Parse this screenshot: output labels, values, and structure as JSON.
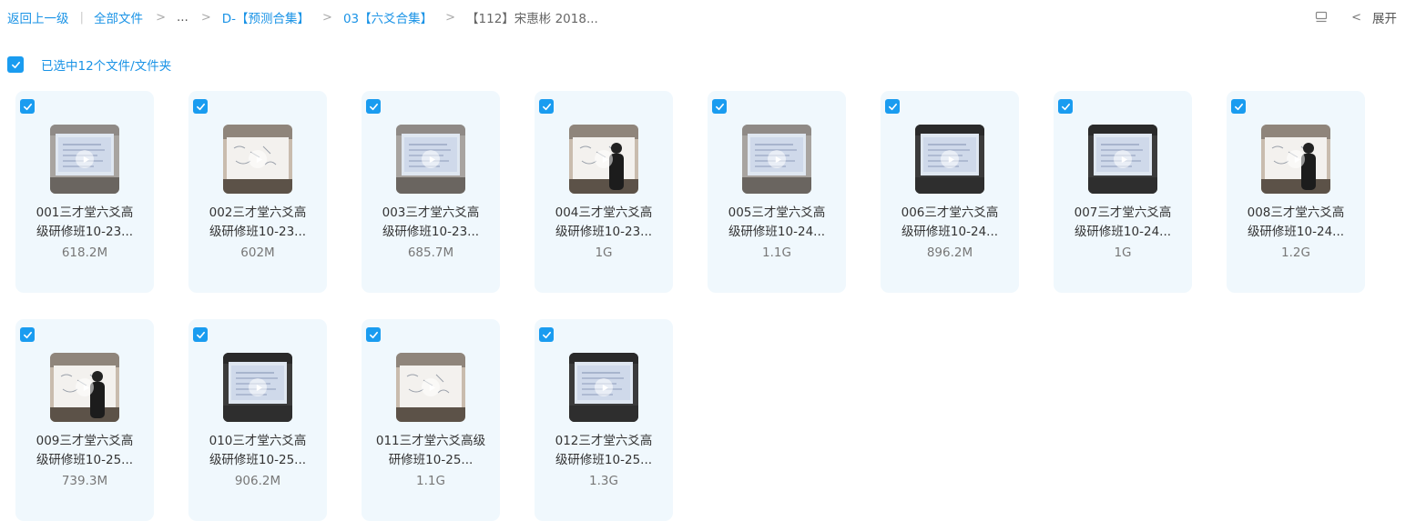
{
  "breadcrumb": {
    "back": "返回上一级",
    "all_files": "全部文件",
    "ellipsis": "...",
    "folder1": "D-【预测合集】",
    "folder2": "03【六爻合集】",
    "current": "【112】宋惠彬 2018..."
  },
  "toolbar": {
    "expand": "展开"
  },
  "selection": {
    "text": "已选中12个文件/文件夹"
  },
  "colors": {
    "accent": "#1a9cf0",
    "card_bg": "#f0f8fd"
  },
  "files": [
    {
      "line1": "001三才堂六爻高",
      "line2": "级研修班10-23...",
      "size": "618.2M",
      "thumb": "projector"
    },
    {
      "line1": "002三才堂六爻高",
      "line2": "级研修班10-23...",
      "size": "602M",
      "thumb": "whiteboard"
    },
    {
      "line1": "003三才堂六爻高",
      "line2": "级研修班10-23...",
      "size": "685.7M",
      "thumb": "projector"
    },
    {
      "line1": "004三才堂六爻高",
      "line2": "级研修班10-23...",
      "size": "1G",
      "thumb": "whiteboard-person"
    },
    {
      "line1": "005三才堂六爻高",
      "line2": "级研修班10-24...",
      "size": "1.1G",
      "thumb": "projector"
    },
    {
      "line1": "006三才堂六爻高",
      "line2": "级研修班10-24...",
      "size": "896.2M",
      "thumb": "projector-dark"
    },
    {
      "line1": "007三才堂六爻高",
      "line2": "级研修班10-24...",
      "size": "1G",
      "thumb": "projector-dark"
    },
    {
      "line1": "008三才堂六爻高",
      "line2": "级研修班10-24...",
      "size": "1.2G",
      "thumb": "whiteboard-person"
    },
    {
      "line1": "009三才堂六爻高",
      "line2": "级研修班10-25...",
      "size": "739.3M",
      "thumb": "whiteboard-person"
    },
    {
      "line1": "010三才堂六爻高",
      "line2": "级研修班10-25...",
      "size": "906.2M",
      "thumb": "projector-dark"
    },
    {
      "line1": "011三才堂六爻高级",
      "line2": "研修班10-25...",
      "size": "1.1G",
      "thumb": "whiteboard"
    },
    {
      "line1": "012三才堂六爻高",
      "line2": "级研修班10-25...",
      "size": "1.3G",
      "thumb": "projector-dark"
    }
  ]
}
